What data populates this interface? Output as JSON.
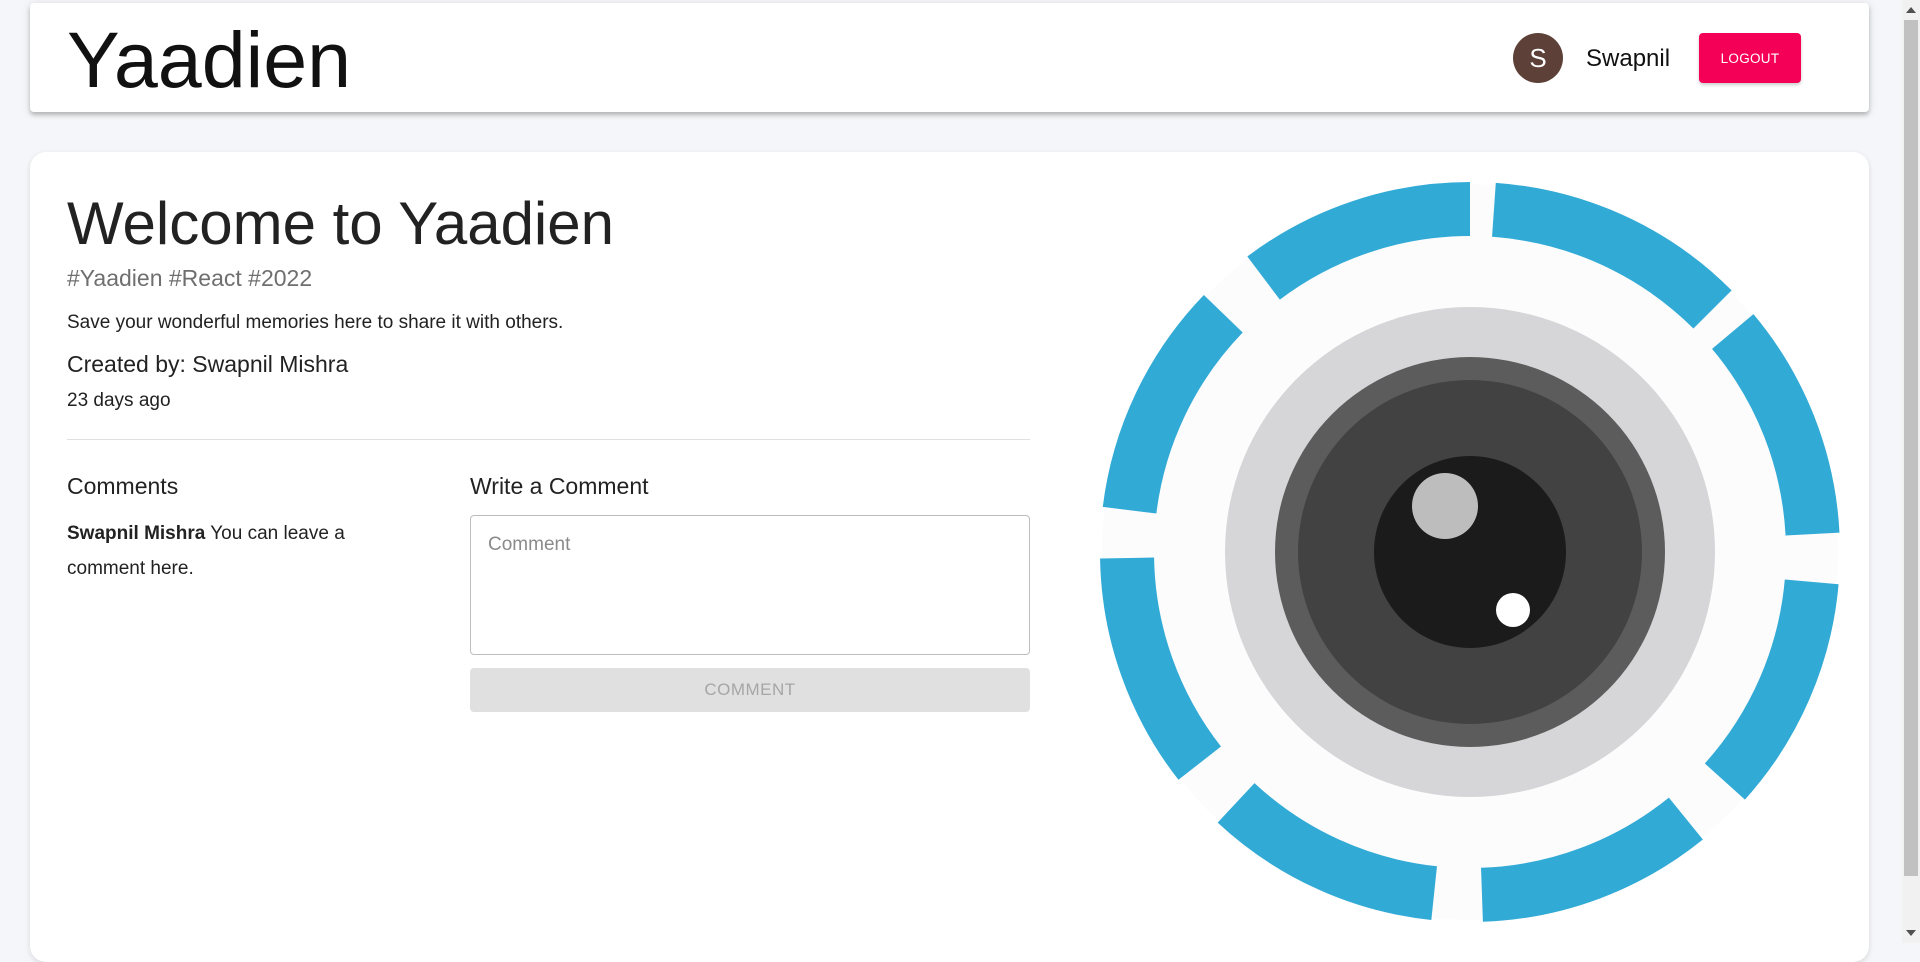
{
  "header": {
    "brand": "Yaadien",
    "avatar_initial": "S",
    "user_name": "Swapnil",
    "logout_label": "LOGOUT"
  },
  "post": {
    "title": "Welcome to Yaadien",
    "tags": "#Yaadien #React #2022",
    "message": "Save your wonderful memories here to share it with others.",
    "created_by": "Created by: Swapnil Mishra",
    "time_ago": "23 days ago",
    "image_icon": "camera-lens-icon"
  },
  "comments": {
    "heading": "Comments",
    "items": [
      {
        "author": "Swapnil Mishra",
        "text": "You can leave a comment here."
      }
    ]
  },
  "write_comment": {
    "heading": "Write a Comment",
    "placeholder": "Comment",
    "value": "",
    "button_label": "COMMENT"
  },
  "colors": {
    "accent": "#f50057",
    "avatar_bg": "#5d4037",
    "lens_ring": "#31aad6",
    "disabled_bg": "#e0e0e0"
  }
}
